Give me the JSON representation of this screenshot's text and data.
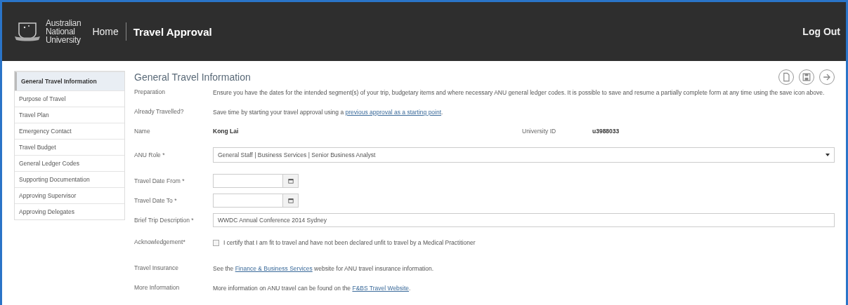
{
  "header": {
    "logo_text": [
      "Australian",
      "National",
      "University"
    ],
    "home": "Home",
    "title": "Travel Approval",
    "logout": "Log Out"
  },
  "sidebar": {
    "items": [
      {
        "label": "General Travel Information",
        "selected": true
      },
      {
        "label": "Purpose of Travel",
        "selected": false
      },
      {
        "label": "Travel Plan",
        "selected": false
      },
      {
        "label": "Emergency Contact",
        "selected": false
      },
      {
        "label": "Travel Budget",
        "selected": false
      },
      {
        "label": "General Ledger Codes",
        "selected": false
      },
      {
        "label": "Supporting Documentation",
        "selected": false
      },
      {
        "label": "Approving Supervisor",
        "selected": false
      },
      {
        "label": "Approving Delegates",
        "selected": false
      }
    ]
  },
  "form": {
    "title": "General Travel Information",
    "preparation": {
      "label": "Preparation",
      "text": "Ensure you have the dates for the intended segment(s) of your trip, budgetary items and where necessary ANU general ledger codes. It is possible to save and resume a partially complete form at any time using the save icon above."
    },
    "already": {
      "label": "Already Travelled?",
      "parts": [
        {
          "kind": "text",
          "text": "Save time by starting your travel approval using a "
        },
        {
          "kind": "link",
          "text": "previous approval as a starting point"
        },
        {
          "kind": "text",
          "text": "."
        }
      ]
    },
    "name": {
      "label": "Name",
      "value": "Kong Lai",
      "id_label": "University ID",
      "id_value": "u3988033"
    },
    "role": {
      "label": "ANU Role *",
      "value": "General Staff | Business Services | Senior Business Analyst"
    },
    "date_from": {
      "label": "Travel Date From *"
    },
    "date_to": {
      "label": "Travel Date To *"
    },
    "description": {
      "label": "Brief Trip Description *",
      "value": "WWDC Annual Conference 2014 Sydney"
    },
    "acknowledgement": {
      "label": "Acknowledgement*",
      "text": "I certify that I am fit to travel and have not been declared unfit to travel by a Medical Practitioner",
      "checked": false
    },
    "insurance": {
      "label": "Travel Insurance",
      "parts": [
        {
          "kind": "text",
          "text": "See the "
        },
        {
          "kind": "link",
          "text": "Finance & Business Services"
        },
        {
          "kind": "text",
          "text": " website for ANU travel insurance information."
        }
      ]
    },
    "more": {
      "label": "More Information",
      "parts": [
        {
          "kind": "text",
          "text": "More information on ANU travel can be found on the "
        },
        {
          "kind": "link",
          "text": "F&BS Travel Website"
        },
        {
          "kind": "text",
          "text": "."
        }
      ]
    }
  }
}
